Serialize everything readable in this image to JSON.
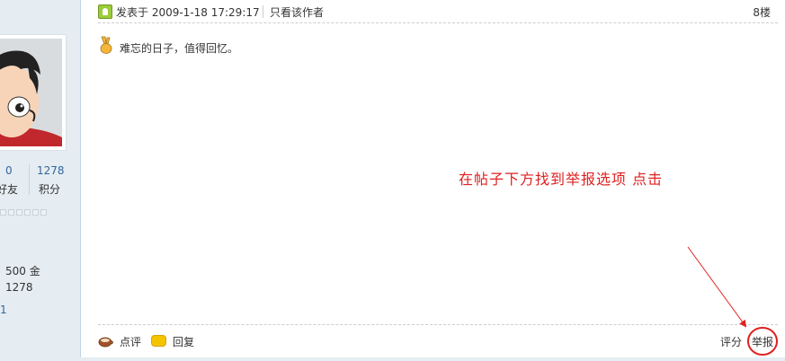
{
  "sidebar": {
    "stats": [
      {
        "value": "0",
        "label": "好友"
      },
      {
        "value": "1278",
        "label": "积分"
      }
    ],
    "info_lines": [
      "500 金",
      "1278"
    ],
    "link_text": "1"
  },
  "post": {
    "posted_time": "发表于 2009-1-18 17:29:17",
    "only_author_label": "只看该作者",
    "floor": "8楼",
    "content": "难忘的日子，值得回忆。",
    "icons": {
      "status": "online-icon",
      "emoji": "victory-hand-icon"
    }
  },
  "annotation": {
    "text": "在帖子下方找到举报选项  点击",
    "color": "#e02020"
  },
  "footer": {
    "comment_label": "点评",
    "reply_label": "回复",
    "rate_label": "评分",
    "report_label": "举报"
  },
  "colors": {
    "sidebar_bg": "#e5edf2",
    "link": "#336699",
    "annotation": "#e02020"
  }
}
